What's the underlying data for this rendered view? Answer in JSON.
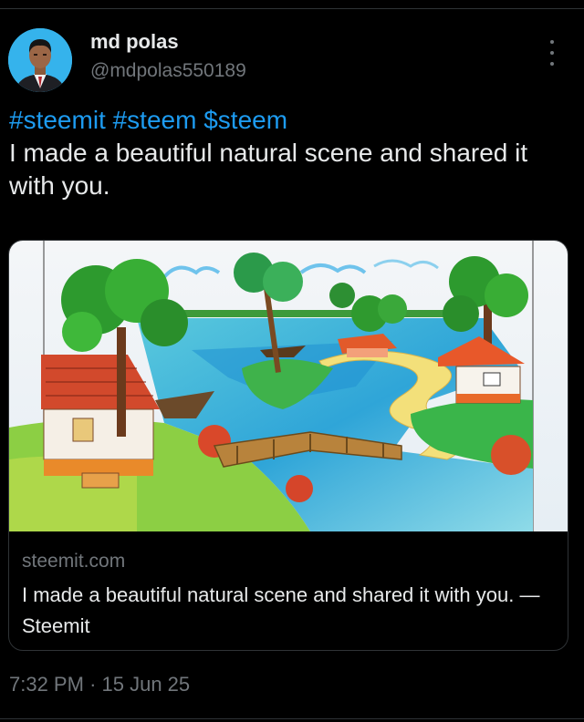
{
  "post": {
    "author_name": "md polas",
    "author_handle": "@mdpolas550189",
    "hashtags": [
      "#steemit",
      "#steem",
      "$steem"
    ],
    "body": "I made a beautiful natural scene and shared it with you.",
    "time": "7:32 PM",
    "separator": "·",
    "date": "15 Jun 25"
  },
  "card": {
    "domain": "steemit.com",
    "title": "I made a beautiful natural scene and shared it with you. — Steemit",
    "image_icon": "drawing-of-village-river-scene"
  },
  "colors": {
    "background": "#000000",
    "text": "#e7e9ea",
    "secondary": "#71767b",
    "link": "#1d9bf0",
    "border": "#2f3336"
  }
}
